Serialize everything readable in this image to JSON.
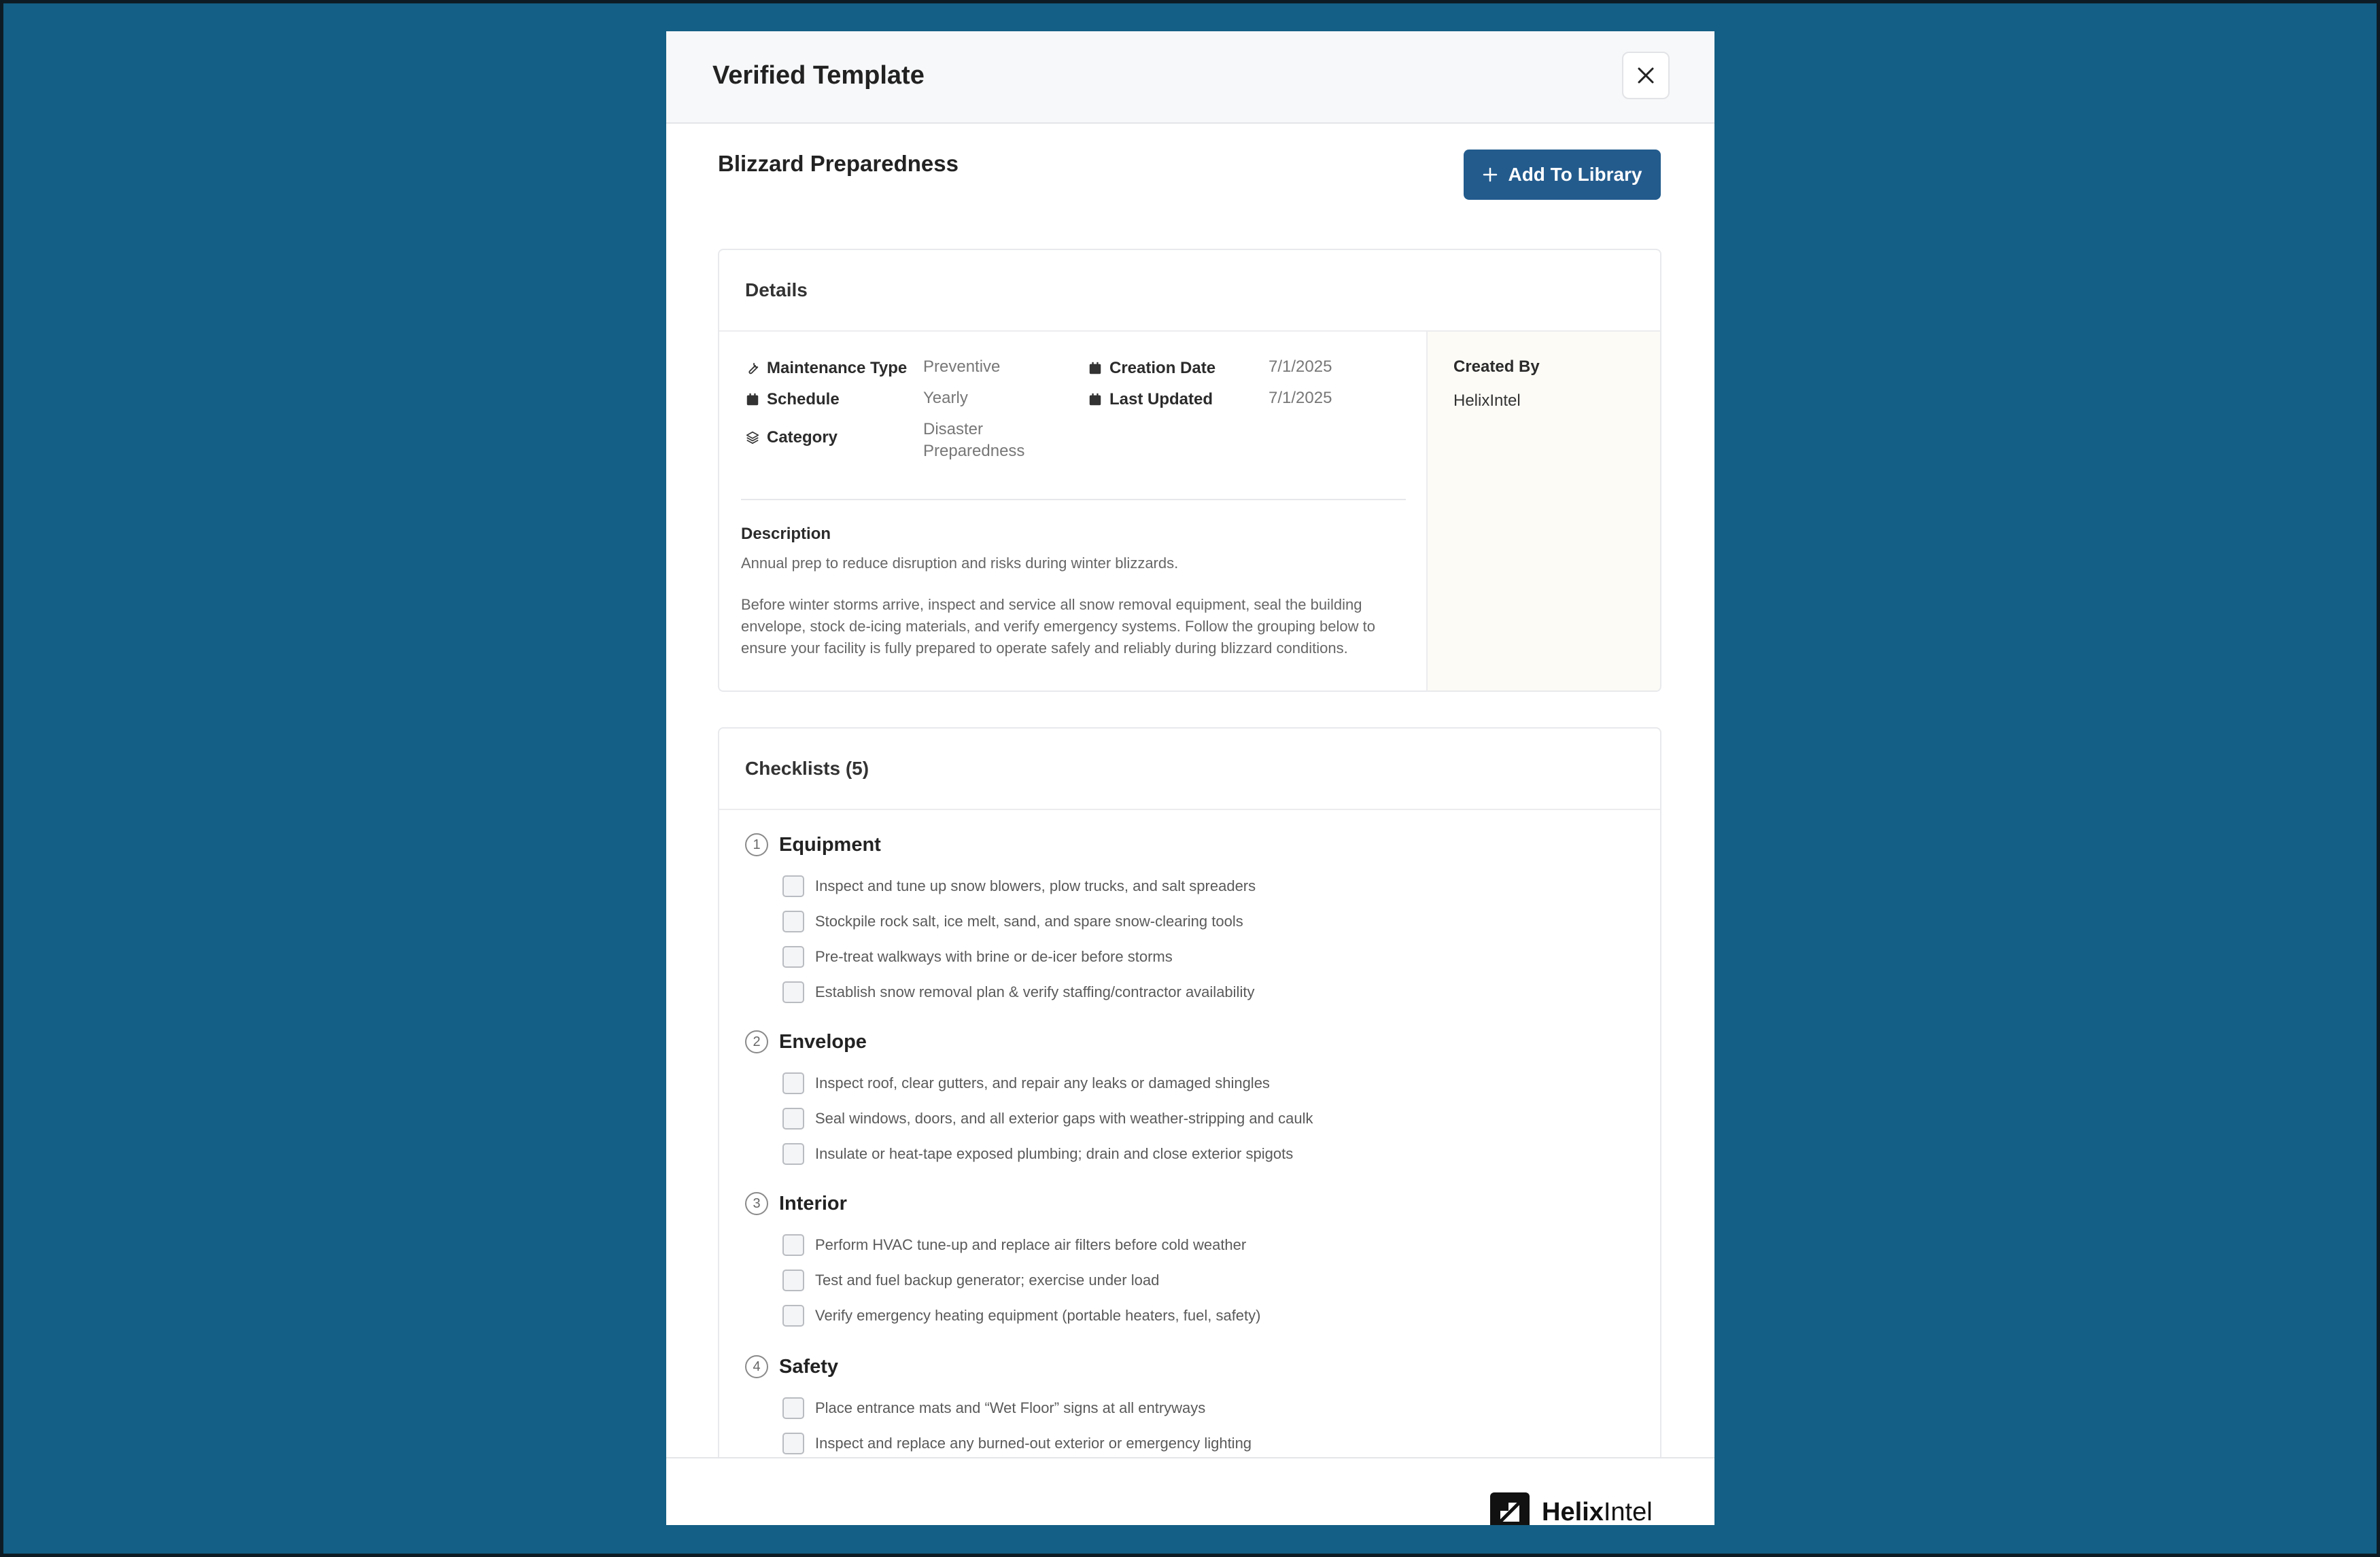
{
  "modal": {
    "title": "Verified Template",
    "close_icon": "close-icon"
  },
  "template": {
    "name": "Blizzard Preparedness",
    "add_button_label": "Add To Library",
    "add_icon": "plus-icon"
  },
  "details": {
    "header": "Details",
    "maintenance_type": {
      "label": "Maintenance Type",
      "value": "Preventive",
      "icon": "wrench-icon"
    },
    "schedule": {
      "label": "Schedule",
      "value": "Yearly",
      "icon": "calendar-icon"
    },
    "category": {
      "label": "Category",
      "value_line1": "Disaster",
      "value_line2": "Preparedness",
      "icon": "layers-icon"
    },
    "creation_date": {
      "label": "Creation Date",
      "value": "7/1/2025",
      "icon": "calendar-icon"
    },
    "last_updated": {
      "label": "Last Updated",
      "value": "7/1/2025",
      "icon": "calendar-icon"
    },
    "created_by": {
      "label": "Created By",
      "value": "HelixIntel"
    },
    "description": {
      "title": "Description",
      "short": "Annual prep to reduce disruption and risks during winter blizzards.",
      "long": "Before winter storms arrive, inspect and service all snow removal equipment, seal the building envelope, stock de-icing materials, and verify emergency systems. Follow the grouping below to ensure your facility is fully prepared to operate safely and reliably during blizzard conditions."
    }
  },
  "checklists": {
    "header": "Checklists (5)",
    "groups": [
      {
        "number": "1",
        "title": "Equipment",
        "items": [
          "Inspect and tune up snow blowers, plow trucks, and salt spreaders",
          "Stockpile rock salt, ice melt, sand, and spare snow-clearing tools",
          "Pre-treat walkways with brine or de-icer before storms",
          "Establish snow removal plan & verify staffing/contractor availability"
        ]
      },
      {
        "number": "2",
        "title": "Envelope",
        "items": [
          "Inspect roof, clear gutters, and repair any leaks or damaged shingles",
          "Seal windows, doors, and all exterior gaps with weather-stripping and caulk",
          "Insulate or heat-tape exposed plumbing; drain and close exterior spigots"
        ]
      },
      {
        "number": "3",
        "title": "Interior",
        "items": [
          "Perform HVAC tune-up and replace air filters before cold weather",
          "Test and fuel backup generator; exercise under load",
          "Verify emergency heating equipment (portable heaters, fuel, safety)"
        ]
      },
      {
        "number": "4",
        "title": "Safety",
        "items": [
          "Place entrance mats and “Wet Floor” signs at all entryways",
          "Inspect and replace any burned-out exterior or emergency lighting"
        ]
      }
    ]
  },
  "footer": {
    "logo_bold": "Helix",
    "logo_light": "Intel"
  },
  "colors": {
    "background": "#145f85",
    "primary_button": "#235b8d",
    "created_panel": "#fcfbf6"
  }
}
